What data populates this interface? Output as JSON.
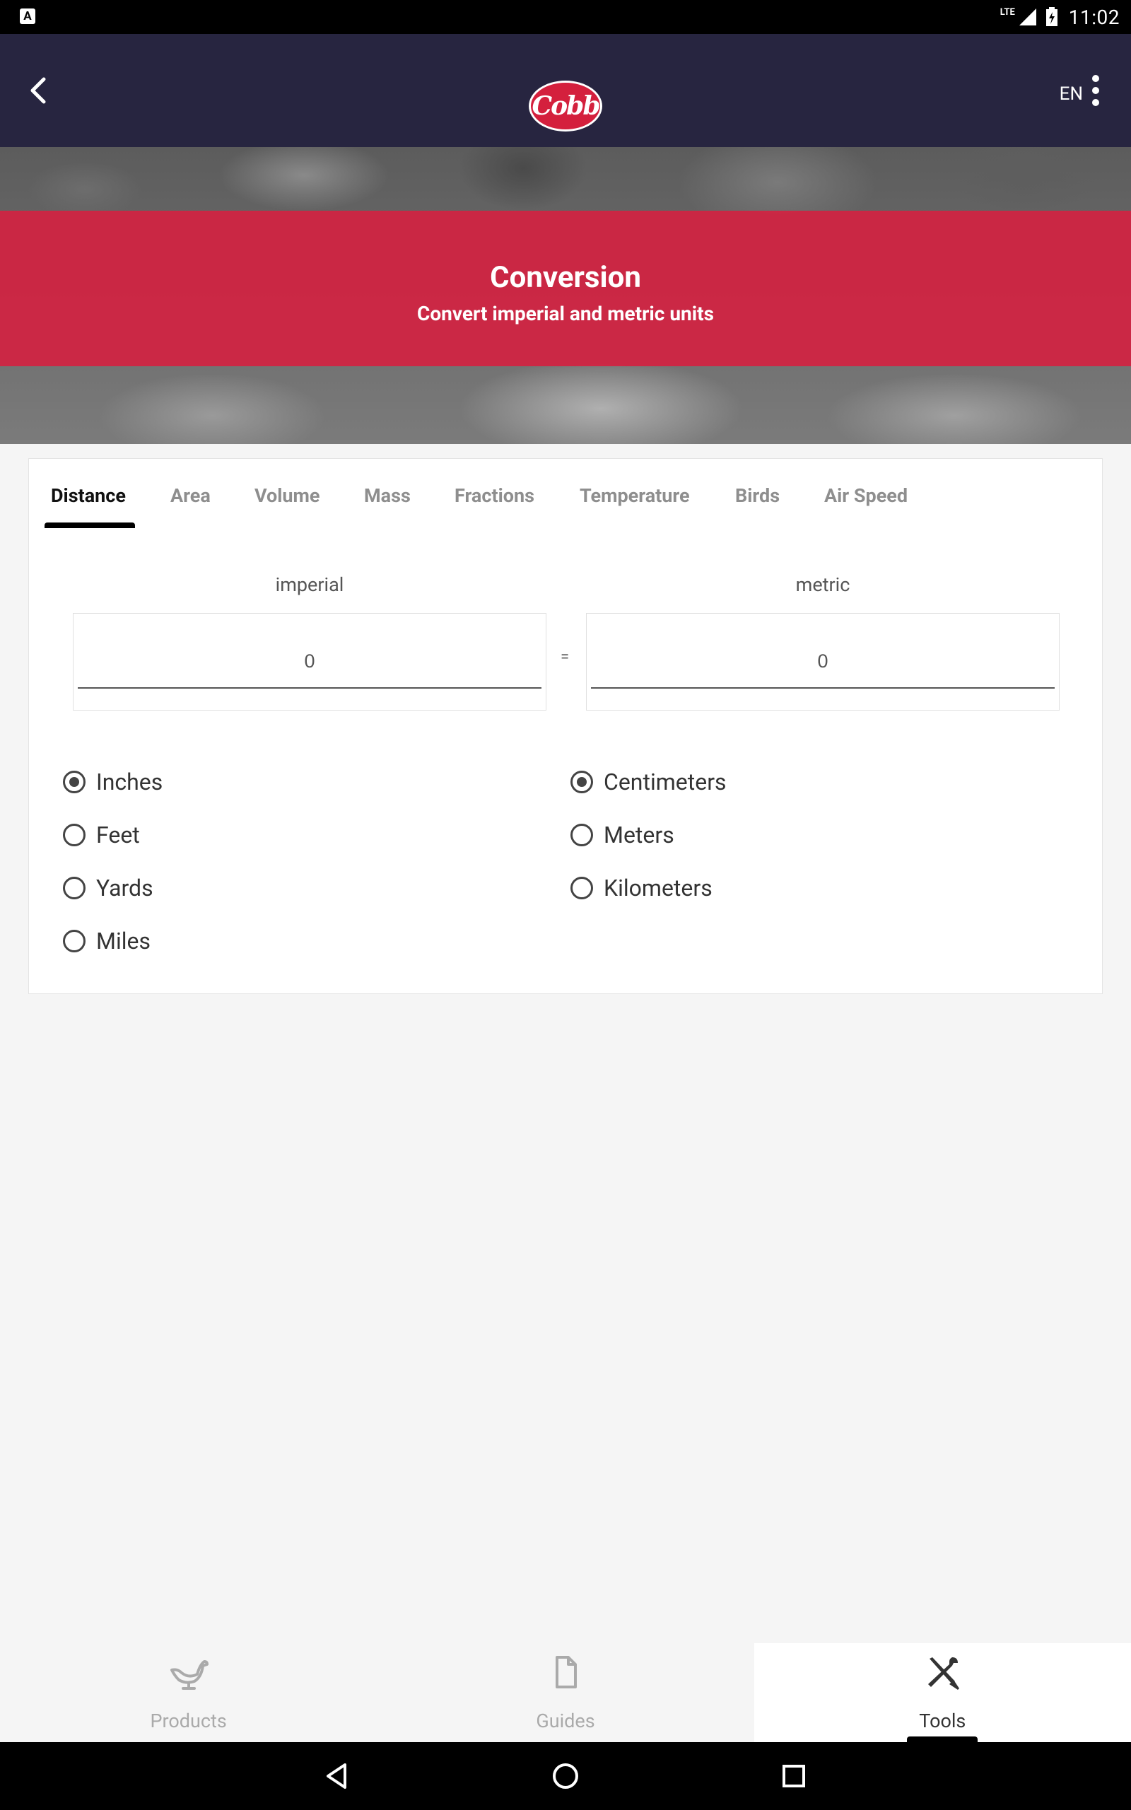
{
  "status_bar": {
    "left_badge": "A",
    "network": "LTE",
    "time": "11:02"
  },
  "app_bar": {
    "logo_text": "Cobb",
    "language": "EN"
  },
  "hero": {
    "title": "Conversion",
    "subtitle": "Convert imperial and metric units",
    "banner_color": "#d22242"
  },
  "tabs": [
    {
      "label": "Distance",
      "active": true
    },
    {
      "label": "Area"
    },
    {
      "label": "Volume"
    },
    {
      "label": "Mass"
    },
    {
      "label": "Fractions"
    },
    {
      "label": "Temperature"
    },
    {
      "label": "Birds"
    },
    {
      "label": "Air Speed"
    }
  ],
  "converter": {
    "imperial_label": "imperial",
    "metric_label": "metric",
    "imperial_value": "0",
    "metric_value": "0",
    "equals": "="
  },
  "imperial_units": [
    {
      "label": "Inches",
      "checked": true
    },
    {
      "label": "Feet"
    },
    {
      "label": "Yards"
    },
    {
      "label": "Miles"
    }
  ],
  "metric_units": [
    {
      "label": "Centimeters",
      "checked": true
    },
    {
      "label": "Meters"
    },
    {
      "label": "Kilometers"
    }
  ],
  "bottom_nav": [
    {
      "label": "Products",
      "icon": "bird-icon"
    },
    {
      "label": "Guides",
      "icon": "document-icon"
    },
    {
      "label": "Tools",
      "icon": "tools-icon",
      "active": true
    }
  ]
}
